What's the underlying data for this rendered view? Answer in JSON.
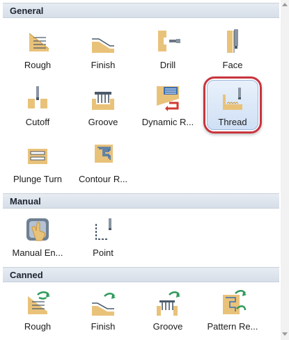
{
  "sections": {
    "general": {
      "title": "General",
      "tools": [
        {
          "label": "Rough",
          "icon": "rough-icon"
        },
        {
          "label": "Finish",
          "icon": "finish-icon"
        },
        {
          "label": "Drill",
          "icon": "drill-icon"
        },
        {
          "label": "Face",
          "icon": "face-icon"
        },
        {
          "label": "Cutoff",
          "icon": "cutoff-icon"
        },
        {
          "label": "Groove",
          "icon": "groove-icon"
        },
        {
          "label": "Dynamic R...",
          "icon": "dynamic-rough-icon"
        },
        {
          "label": "Thread",
          "icon": "thread-icon",
          "selected": true
        },
        {
          "label": "Plunge Turn",
          "icon": "plunge-turn-icon"
        },
        {
          "label": "Contour R...",
          "icon": "contour-rough-icon"
        }
      ]
    },
    "manual": {
      "title": "Manual",
      "tools": [
        {
          "label": "Manual En...",
          "icon": "manual-entry-icon"
        },
        {
          "label": "Point",
          "icon": "point-icon"
        }
      ]
    },
    "canned": {
      "title": "Canned",
      "tools": [
        {
          "label": "Rough",
          "icon": "canned-rough-icon"
        },
        {
          "label": "Finish",
          "icon": "canned-finish-icon"
        },
        {
          "label": "Groove",
          "icon": "canned-groove-icon"
        },
        {
          "label": "Pattern Re...",
          "icon": "pattern-repeat-icon"
        }
      ]
    }
  },
  "colors": {
    "stock": "#e9c27a",
    "stock_dark": "#c9963e",
    "tool_blue": "#3b6fb0",
    "arrow_green": "#2f9a5a",
    "arrow_red": "#d23a32",
    "selection_border": "#c8353d"
  }
}
